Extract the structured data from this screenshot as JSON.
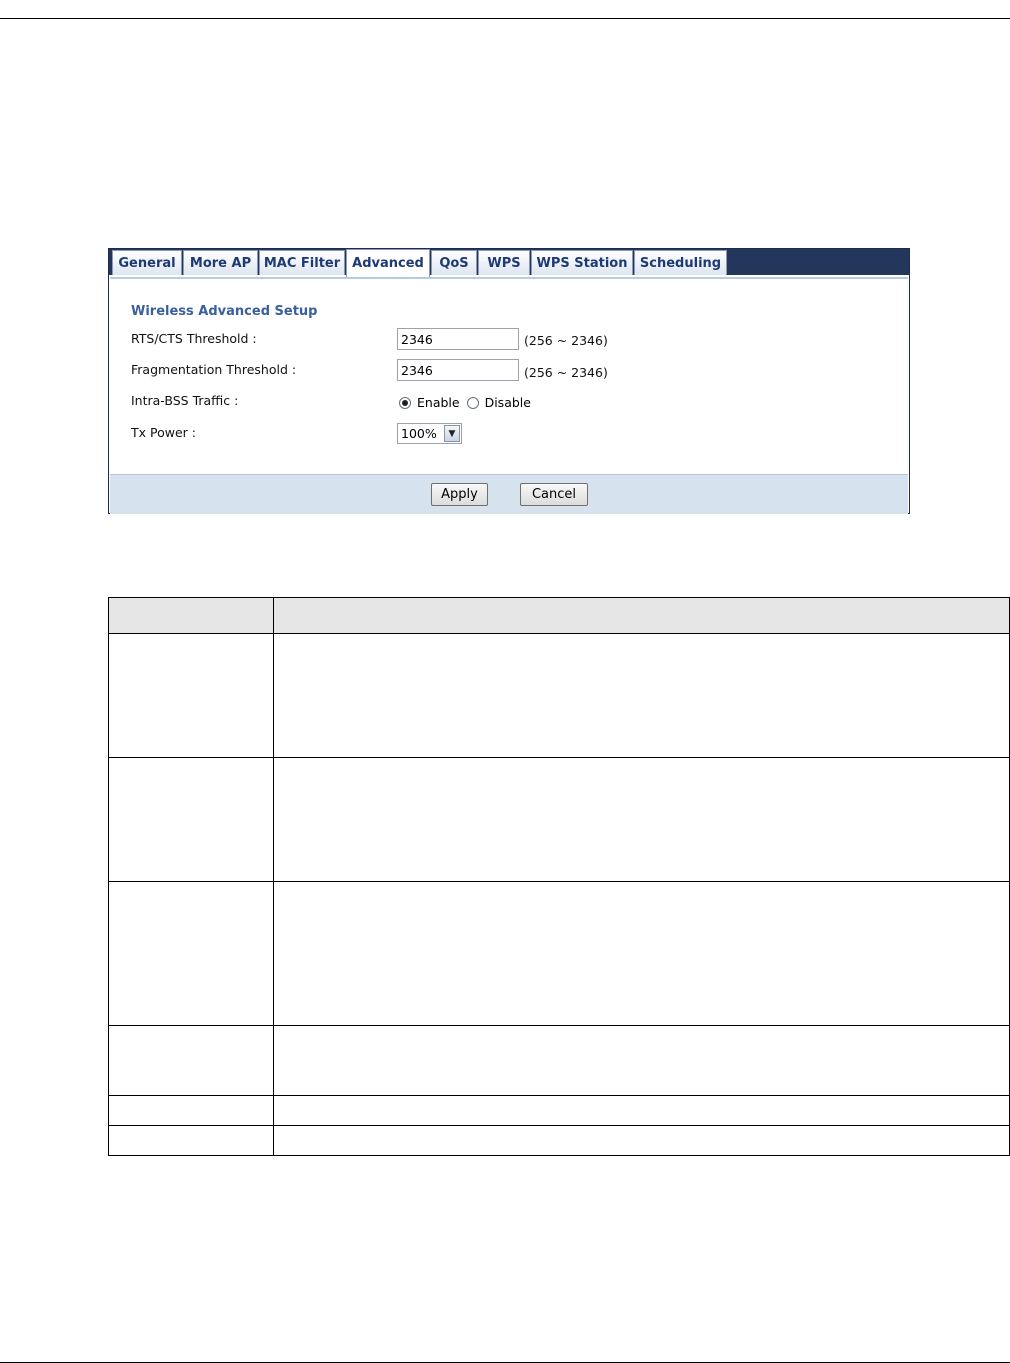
{
  "tabs": [
    {
      "label": "General",
      "active": false
    },
    {
      "label": "More AP",
      "active": false
    },
    {
      "label": "MAC Filter",
      "active": false
    },
    {
      "label": "Advanced",
      "active": true
    },
    {
      "label": "QoS",
      "active": false
    },
    {
      "label": "WPS",
      "active": false
    },
    {
      "label": "WPS Station",
      "active": false
    },
    {
      "label": "Scheduling",
      "active": false
    }
  ],
  "form": {
    "section_title": "Wireless Advanced Setup",
    "rts_label": "RTS/CTS Threshold :",
    "rts_value": "2346",
    "rts_range": "(256 ~ 2346)",
    "frag_label": "Fragmentation Threshold :",
    "frag_value": "2346",
    "frag_range": "(256 ~ 2346)",
    "intra_label": "Intra-BSS Traffic :",
    "enable_label": "Enable",
    "disable_label": "Disable",
    "intra_selected": "Enable",
    "txpower_label": "Tx Power :",
    "txpower_value": "100%"
  },
  "buttons": {
    "apply": "Apply",
    "cancel": "Cancel"
  },
  "colors": {
    "tabbar": "#23365c",
    "tab_text": "#1e3a75",
    "section_title": "#3a5f9c",
    "footer": "#d7e2ef"
  }
}
